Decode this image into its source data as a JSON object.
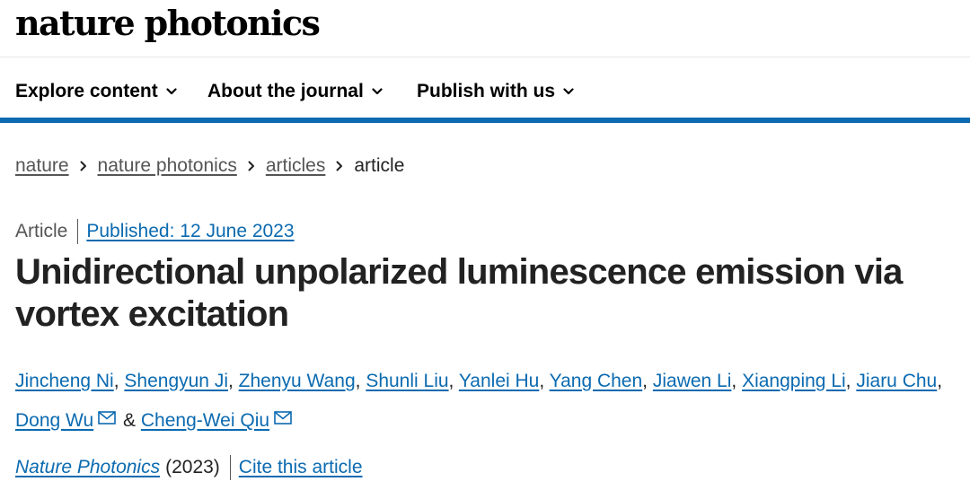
{
  "header": {
    "logo": "nature photonics"
  },
  "nav": {
    "items": [
      {
        "label": "Explore content"
      },
      {
        "label": "About the journal"
      },
      {
        "label": "Publish with us"
      }
    ]
  },
  "breadcrumb": {
    "items": [
      "nature",
      "nature photonics",
      "articles"
    ],
    "current": "article"
  },
  "article": {
    "type": "Article",
    "published": "Published: 12 June 2023",
    "title": "Unidirectional unpolarized luminescence emission via vortex excitation",
    "authors": [
      "Jincheng Ni",
      "Shengyun Ji",
      "Zhenyu Wang",
      "Shunli Liu",
      "Yanlei Hu",
      "Yang Chen",
      "Jiawen Li",
      "Xiangping Li",
      "Jiaru Chu",
      "Dong Wu",
      "Cheng-Wei Qiu"
    ],
    "author_separator": ", ",
    "author_conjunction": " & ",
    "journal": "Nature Photonics",
    "year": "(2023)",
    "cite_label": "Cite this article"
  },
  "colors": {
    "link": "#0b6ab0",
    "nav_rule": "#0b6ab0",
    "text": "#222222",
    "muted": "#555555"
  },
  "icons": {
    "nav_chevron": "chevron-down-icon",
    "breadcrumb_separator": "chevron-right-icon",
    "corresponding_author": "mail-icon"
  }
}
